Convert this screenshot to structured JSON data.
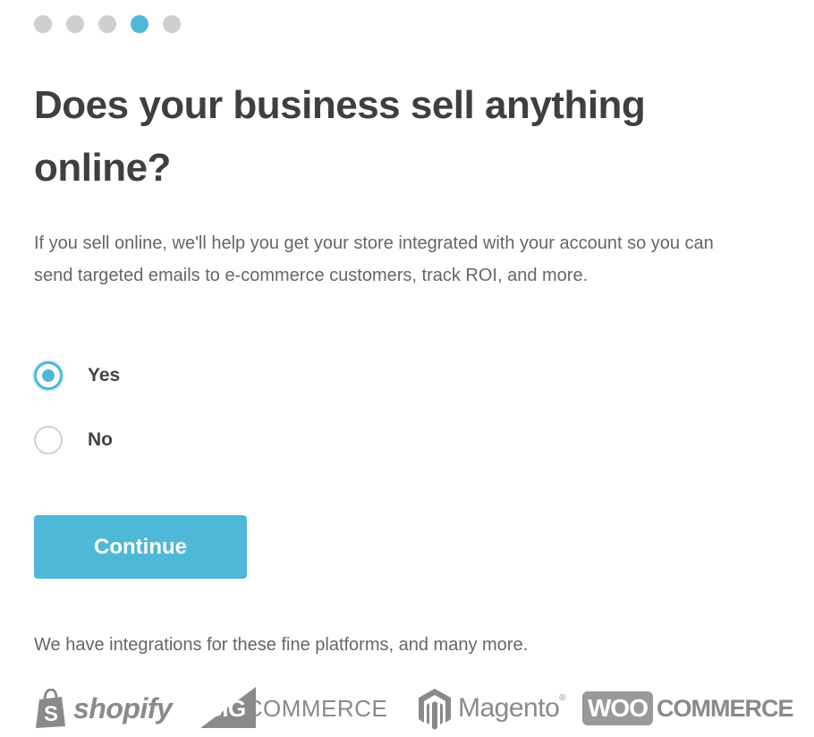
{
  "progress": {
    "total_steps": 5,
    "current_step": 4
  },
  "question": {
    "title": "Does your business sell anything online?",
    "description": "If you sell online, we'll help you get your store integrated with your account so you can send targeted emails to e-commerce customers, track ROI, and more."
  },
  "options": [
    {
      "label": "Yes",
      "selected": true
    },
    {
      "label": "No",
      "selected": false
    }
  ],
  "continue_button": {
    "label": "Continue"
  },
  "integrations": {
    "text": "We have integrations for these fine platforms, and many more.",
    "logos": {
      "shopify": "shopify",
      "bigcommerce_prefix": "BIG",
      "bigcommerce_suffix": "COMMERCE",
      "magento": "Magento",
      "magento_mark": "®",
      "woo_prefix": "WOO",
      "woo_suffix": "COMMERCE"
    }
  },
  "colors": {
    "accent": "#4fb8d7",
    "dot_inactive": "#cfcfcf",
    "title_text": "#3f3f3f",
    "body_text": "#666666",
    "logo_gray": "#8a8a8a"
  },
  "icons": {
    "shopify": "shopping-bag-icon",
    "bigcommerce": "bigcommerce-mark-icon",
    "magento": "magento-hex-icon"
  }
}
